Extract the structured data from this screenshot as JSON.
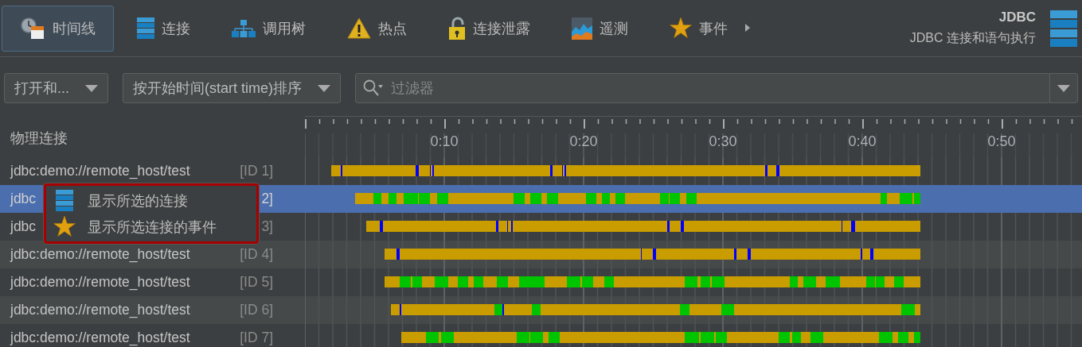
{
  "tabs": [
    {
      "label": "时间线",
      "kind": "timeline",
      "selected": true
    },
    {
      "label": "连接",
      "kind": "database",
      "selected": false
    },
    {
      "label": "调用树",
      "kind": "tree",
      "selected": false
    },
    {
      "label": "热点",
      "kind": "warning",
      "selected": false
    },
    {
      "label": "连接泄露",
      "kind": "lock",
      "selected": false
    },
    {
      "label": "遥测",
      "kind": "telemetry",
      "selected": false
    },
    {
      "label": "事件",
      "kind": "star",
      "selected": false
    }
  ],
  "header": {
    "title": "JDBC",
    "subtitle": "JDBC 连接和语句执行"
  },
  "toolbar": {
    "dropdowns": [
      {
        "value": "打开和..."
      },
      {
        "value": "按开始时间(start time)排序"
      }
    ],
    "filter": {
      "placeholder": "过滤器"
    }
  },
  "list": {
    "column_header": "物理连接",
    "rows": [
      {
        "url": "jdbc:demo://remote_host/test",
        "id": "[ID 1]",
        "selected": false
      },
      {
        "url": "jdbc",
        "id": "2]",
        "selected": true
      },
      {
        "url": "jdbc",
        "id": "3]",
        "selected": false
      },
      {
        "url": "jdbc:demo://remote_host/test",
        "id": "[ID 4]",
        "selected": false
      },
      {
        "url": "jdbc:demo://remote_host/test",
        "id": "[ID 5]",
        "selected": false
      },
      {
        "url": "jdbc:demo://remote_host/test",
        "id": "[ID 6]",
        "selected": false
      },
      {
        "url": "jdbc:demo://remote_host/test",
        "id": "[ID 7]",
        "selected": false
      }
    ]
  },
  "timeline": {
    "axis_labels": [
      "0:10",
      "0:20",
      "0:30",
      "0:40",
      "0:50"
    ]
  },
  "context_menu": {
    "items": [
      {
        "label": "显示所选的连接",
        "kind": "database"
      },
      {
        "label": "显示所选连接的事件",
        "kind": "star"
      }
    ]
  }
}
